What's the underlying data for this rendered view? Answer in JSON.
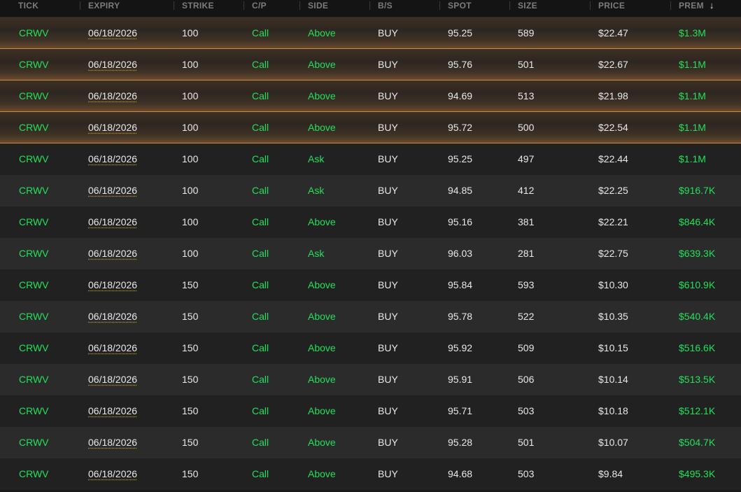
{
  "columns": {
    "tick": "TICK",
    "expiry": "EXPIRY",
    "strike": "STRIKE",
    "cp": "C/P",
    "side": "SIDE",
    "bs": "B/S",
    "spot": "SPOT",
    "size": "SIZE",
    "price": "PRICE",
    "prem": "PREM"
  },
  "sort_icon": "arrow-down-icon",
  "colors": {
    "accent_green": "#22e05a",
    "highlight_border": "#c98a4a"
  },
  "rows": [
    {
      "tick": "CRWV",
      "expiry": "06/18/2026",
      "strike": "100",
      "cp": "Call",
      "side": "Above",
      "bs": "BUY",
      "spot": "95.25",
      "size": "589",
      "price": "$22.47",
      "prem": "$1.3M",
      "highlighted": true
    },
    {
      "tick": "CRWV",
      "expiry": "06/18/2026",
      "strike": "100",
      "cp": "Call",
      "side": "Above",
      "bs": "BUY",
      "spot": "95.76",
      "size": "501",
      "price": "$22.67",
      "prem": "$1.1M",
      "highlighted": true
    },
    {
      "tick": "CRWV",
      "expiry": "06/18/2026",
      "strike": "100",
      "cp": "Call",
      "side": "Above",
      "bs": "BUY",
      "spot": "94.69",
      "size": "513",
      "price": "$21.98",
      "prem": "$1.1M",
      "highlighted": true
    },
    {
      "tick": "CRWV",
      "expiry": "06/18/2026",
      "strike": "100",
      "cp": "Call",
      "side": "Above",
      "bs": "BUY",
      "spot": "95.72",
      "size": "500",
      "price": "$22.54",
      "prem": "$1.1M",
      "highlighted": true
    },
    {
      "tick": "CRWV",
      "expiry": "06/18/2026",
      "strike": "100",
      "cp": "Call",
      "side": "Ask",
      "bs": "BUY",
      "spot": "95.25",
      "size": "497",
      "price": "$22.44",
      "prem": "$1.1M",
      "highlighted": false
    },
    {
      "tick": "CRWV",
      "expiry": "06/18/2026",
      "strike": "100",
      "cp": "Call",
      "side": "Ask",
      "bs": "BUY",
      "spot": "94.85",
      "size": "412",
      "price": "$22.25",
      "prem": "$916.7K",
      "highlighted": false
    },
    {
      "tick": "CRWV",
      "expiry": "06/18/2026",
      "strike": "100",
      "cp": "Call",
      "side": "Above",
      "bs": "BUY",
      "spot": "95.16",
      "size": "381",
      "price": "$22.21",
      "prem": "$846.4K",
      "highlighted": false
    },
    {
      "tick": "CRWV",
      "expiry": "06/18/2026",
      "strike": "100",
      "cp": "Call",
      "side": "Ask",
      "bs": "BUY",
      "spot": "96.03",
      "size": "281",
      "price": "$22.75",
      "prem": "$639.3K",
      "highlighted": false
    },
    {
      "tick": "CRWV",
      "expiry": "06/18/2026",
      "strike": "150",
      "cp": "Call",
      "side": "Above",
      "bs": "BUY",
      "spot": "95.84",
      "size": "593",
      "price": "$10.30",
      "prem": "$610.9K",
      "highlighted": false
    },
    {
      "tick": "CRWV",
      "expiry": "06/18/2026",
      "strike": "150",
      "cp": "Call",
      "side": "Above",
      "bs": "BUY",
      "spot": "95.78",
      "size": "522",
      "price": "$10.35",
      "prem": "$540.4K",
      "highlighted": false
    },
    {
      "tick": "CRWV",
      "expiry": "06/18/2026",
      "strike": "150",
      "cp": "Call",
      "side": "Above",
      "bs": "BUY",
      "spot": "95.92",
      "size": "509",
      "price": "$10.15",
      "prem": "$516.6K",
      "highlighted": false
    },
    {
      "tick": "CRWV",
      "expiry": "06/18/2026",
      "strike": "150",
      "cp": "Call",
      "side": "Above",
      "bs": "BUY",
      "spot": "95.91",
      "size": "506",
      "price": "$10.14",
      "prem": "$513.5K",
      "highlighted": false
    },
    {
      "tick": "CRWV",
      "expiry": "06/18/2026",
      "strike": "150",
      "cp": "Call",
      "side": "Above",
      "bs": "BUY",
      "spot": "95.71",
      "size": "503",
      "price": "$10.18",
      "prem": "$512.1K",
      "highlighted": false
    },
    {
      "tick": "CRWV",
      "expiry": "06/18/2026",
      "strike": "150",
      "cp": "Call",
      "side": "Above",
      "bs": "BUY",
      "spot": "95.28",
      "size": "501",
      "price": "$10.07",
      "prem": "$504.7K",
      "highlighted": false
    },
    {
      "tick": "CRWV",
      "expiry": "06/18/2026",
      "strike": "150",
      "cp": "Call",
      "side": "Above",
      "bs": "BUY",
      "spot": "94.68",
      "size": "503",
      "price": "$9.84",
      "prem": "$495.3K",
      "highlighted": false
    }
  ]
}
